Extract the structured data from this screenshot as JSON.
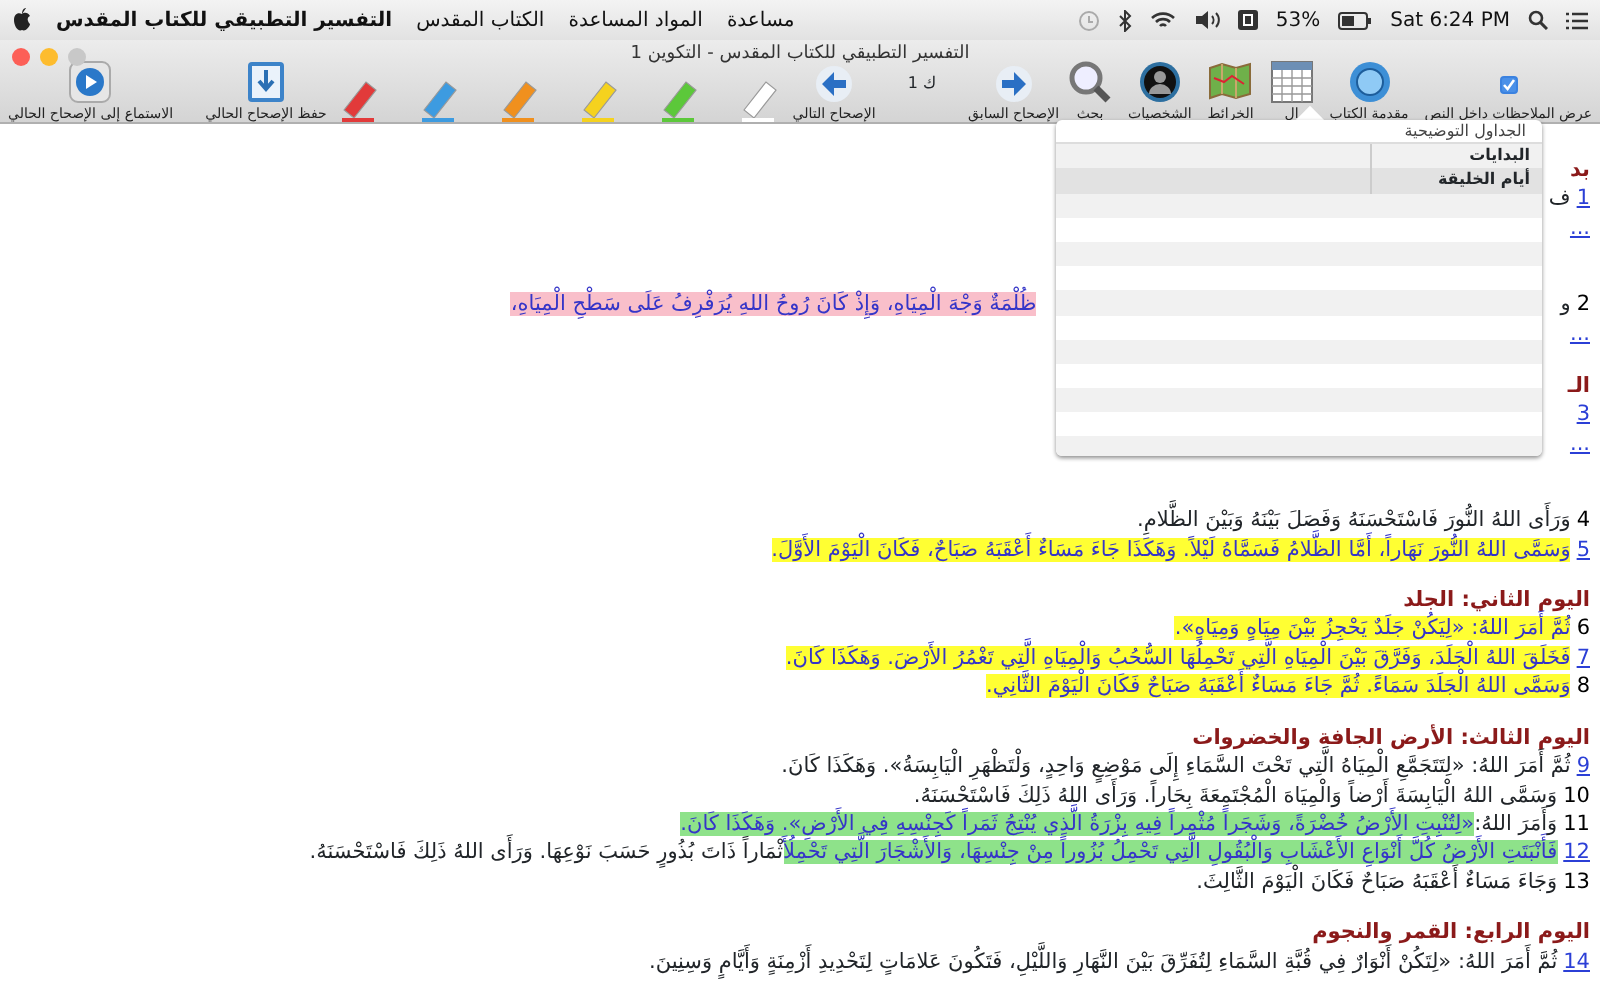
{
  "menu_bar": {
    "app_name": "التفسير التطبيقي للكتاب المقدس",
    "menus": [
      "مساعدة",
      "المواد المساعدة",
      "الكتاب المقدس"
    ],
    "battery": "53%",
    "clock": "Sat 6:24 PM"
  },
  "window": {
    "title": "التفسير التطبيقي للكتاب المقدس - التكوين 1"
  },
  "toolbar": {
    "left": [
      {
        "kind": "save",
        "label": "حفظ الإصحاح الحالي"
      },
      {
        "kind": "play",
        "label": "الاستماع إلى الإصحاح الحالي"
      }
    ],
    "markers": [
      {
        "color": "#e23a3a"
      },
      {
        "color": "#3d9be0"
      },
      {
        "color": "#f0901e"
      },
      {
        "color": "#f5d21e"
      },
      {
        "color": "#5cc83a"
      },
      {
        "color": "#ffffff"
      }
    ],
    "nav": {
      "next_label": "الإصحاح التالي",
      "chapter": "ك 1",
      "prev_label": "الإصحاح السابق"
    },
    "right": [
      {
        "kind": "checkbox",
        "label": "عرض الملاحظات داخل النص",
        "checked": true
      },
      {
        "kind": "intro",
        "label": "مقدمة الكتاب"
      },
      {
        "kind": "table",
        "label": "ال"
      },
      {
        "kind": "map",
        "label": "الخرائط"
      },
      {
        "kind": "people",
        "label": "الشخصيات"
      },
      {
        "kind": "search",
        "label": "بحث"
      }
    ]
  },
  "dropdown": {
    "header": "الجداول التوضيحية",
    "items": [
      {
        "label": "البدايات",
        "selected": false
      },
      {
        "label": "أيام الخليقة",
        "selected": true
      }
    ]
  },
  "passage": [
    {
      "kind": "heading",
      "text": "بد"
    },
    {
      "kind": "verse",
      "number": "1",
      "link": true,
      "segments": [
        {
          "text": "ف"
        }
      ]
    },
    {
      "kind": "more",
      "text": "..."
    },
    {
      "kind": "covered_verse",
      "number": "2",
      "link": false,
      "start": "و",
      "end": "ظُلْمَةٌ وَجْهَ الْمِيَاهِ، وَإِذْ كَانَ رُوحُ اللهِ يُرَفْرِفُ عَلَى سَطْحِ الْمِيَاهِ،",
      "color": "#f9bfca"
    },
    {
      "kind": "more",
      "text": "..."
    },
    {
      "kind": "heading",
      "text": "الـ"
    },
    {
      "kind": "verse",
      "number": "3",
      "link": true
    },
    {
      "kind": "more",
      "text": "..."
    },
    {
      "kind": "verse",
      "number": "4",
      "link": false,
      "segments": [
        {
          "text": "وَرَأَى اللهُ النُّورَ فَاسْتَحْسَنَهُ وَفَصَلَ بَيْنَهُ وَبَيْنَ الظَّلامِ."
        }
      ]
    },
    {
      "kind": "verse",
      "number": "5",
      "link": true,
      "segments": [
        {
          "text": "وَسَمَّى اللهُ النُّورَ نَهَاراً، أَمَّا الظَّلامُ فَسَمَّاهُ لَيْلاً. وَهَكَذَا جَاءَ مَسَاءٌ أَعْقَبَهُ صَبَاحٌ، فَكَانَ الْيَوْمَ الأَوَّلَ.",
          "color": "#ffff33"
        }
      ]
    },
    {
      "kind": "heading",
      "text": "اليوم الثاني: الجلد"
    },
    {
      "kind": "verse",
      "number": "6",
      "link": false,
      "segments": [
        {
          "text": "ثُمَّ أَمَرَ اللهُ: «لِيَكُنْ جَلَدٌ يَحْجِزُ بَيْنَ مِيَاهٍ وَمِيَاهٍ».",
          "color": "#ffff33"
        }
      ]
    },
    {
      "kind": "verse",
      "number": "7",
      "link": true,
      "segments": [
        {
          "text": "فَخَلَقَ اللهُ الْجَلَدَ، وَفَرَّقَ بَيْنَ الْمِيَاهِ الَّتِي تَحْمِلُهَا السُّحُبُ وَالْمِيَاهِ الَّتِي تَغْمُرُ الأَرْضَ. وَهَكَذَا كَانَ.",
          "color": "#ffff33"
        }
      ]
    },
    {
      "kind": "verse",
      "number": "8",
      "link": false,
      "segments": [
        {
          "text": "وَسَمَّى اللهُ الْجَلَدَ سَمَاءً. ثُمَّ جَاءَ مَسَاءٌ أَعْقَبَهُ صَبَاحٌ فَكَانَ الْيَوْمَ الثَّانِي.",
          "color": "#ffff33"
        }
      ]
    },
    {
      "kind": "heading",
      "text": "اليوم الثالث: الأرض الجافة والخضروات"
    },
    {
      "kind": "verse",
      "number": "9",
      "link": true,
      "segments": [
        {
          "text": "ثُمَّ أَمَرَ اللهُ: «لِتَتَجَمَّعِ الْمِيَاهُ الَّتِي تَحْتَ السَّمَاءِ إِلَى مَوْضِعٍ وَاحِدٍ، وَلْتَظْهَرِ الْيَابِسَةُ». وَهَكَذَا كَانَ."
        }
      ]
    },
    {
      "kind": "verse",
      "number": "10",
      "link": false,
      "segments": [
        {
          "text": "وَسَمَّى اللهُ الْيَابِسَةَ أَرْضاً وَالْمِيَاهَ الْمُجْتَمِعَةَ بِحَاراً. وَرَأَى اللهُ ذَلِكَ فَاسْتَحْسَنَهُ."
        }
      ]
    },
    {
      "kind": "verse",
      "number": "11",
      "link": false,
      "segments": [
        {
          "text": "وَأَمَرَ اللهُ:"
        },
        {
          "text": "«لِتُنْبِتِ الأَرْضُ خُضْرَةً، وَشَجَراً مُثْمِراً فِيهِ بِزْرَةُ الَّذِي يُنْتِجُ ثَمَراً كَجِنْسِهِ فِي الأَرْضِ». وَهَكَذَا كَانَ.",
          "color": "#8ee28a"
        }
      ]
    },
    {
      "kind": "verse",
      "number": "12",
      "link": true,
      "segments": [
        {
          "text": "فَأَنْبَتَتِ الأَرْضُ كُلَّ أَنْوَاعِ الأَعْشَابِ وَالْبُقُولِ الَّتِي تَحْمِلُ بُزُوراً مِنْ جِنْسِهَا، وَالأَشْجَارَ الَّتِي تَحْمِلُ",
          "color": "#8ee28a"
        },
        {
          "text": "أَثْمَاراً ذَاتَ بُذُورٍ حَسَبَ نَوْعِهَا. وَرَأَى اللهُ ذَلِكَ فَاسْتَحْسَنَهُ."
        }
      ]
    },
    {
      "kind": "verse",
      "number": "13",
      "link": false,
      "segments": [
        {
          "text": "وَجَاءَ مَسَاءٌ أَعْقَبَهُ صَبَاحٌ فَكَانَ الْيَوْمَ الثَّالِثَ."
        }
      ]
    },
    {
      "kind": "heading",
      "text": "اليوم الرابع: القمر والنجوم"
    },
    {
      "kind": "verse",
      "number": "14",
      "link": true,
      "segments": [
        {
          "text": "ثُمَّ أَمَرَ اللهُ: «لِتَكُنْ أَنْوَارٌ فِي قُبَّةِ السَّمَاءِ لِتُفَرِّقَ بَيْنَ النَّهَارِ وَاللَّيْلِ، فَتَكُونَ عَلامَاتٍ لِتَحْدِيدِ أَزْمِنَةٍ وَأَيَّامٍ وَسِنِينَ."
        }
      ]
    }
  ]
}
